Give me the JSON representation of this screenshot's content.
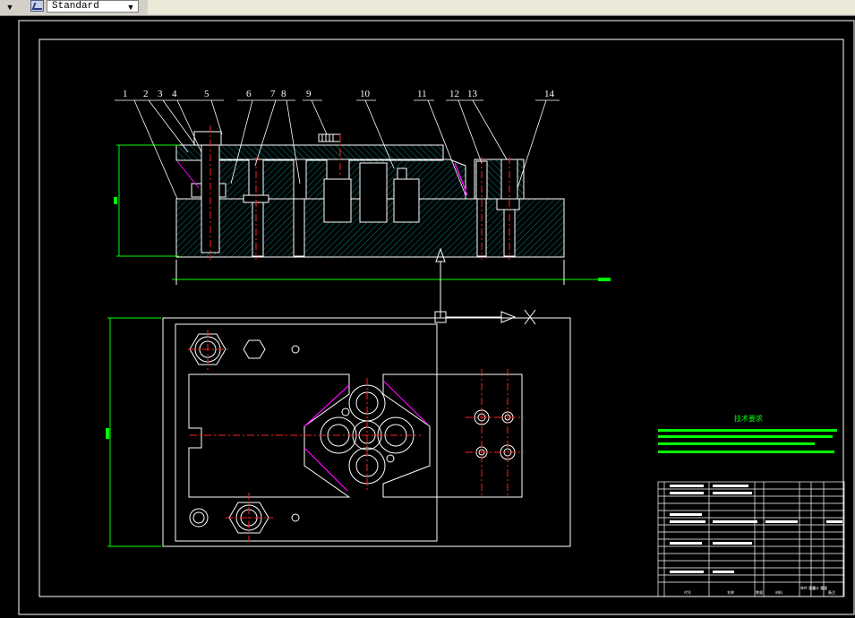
{
  "toolbar": {
    "text_style": "Standard"
  },
  "drawing": {
    "part_labels": [
      "1",
      "2",
      "3",
      "4",
      "5",
      "6",
      "7",
      "8",
      "9",
      "10",
      "11",
      "12",
      "13",
      "14"
    ],
    "tech_title": "技术要求",
    "title_block": {
      "headers": [
        "代号",
        "名称",
        "数量",
        "材料",
        "单件 重量",
        "总计 重量",
        "备注"
      ]
    }
  },
  "colors": {
    "background": "#000000",
    "lines": "#ffffff",
    "hatch": "#00aaaa",
    "dimension": "#00ff00",
    "centerline": "#ff2020",
    "highlight": "#ff00ff"
  },
  "icons": [
    "chevron-down-icon",
    "text-style-icon",
    "ucs-icon"
  ]
}
